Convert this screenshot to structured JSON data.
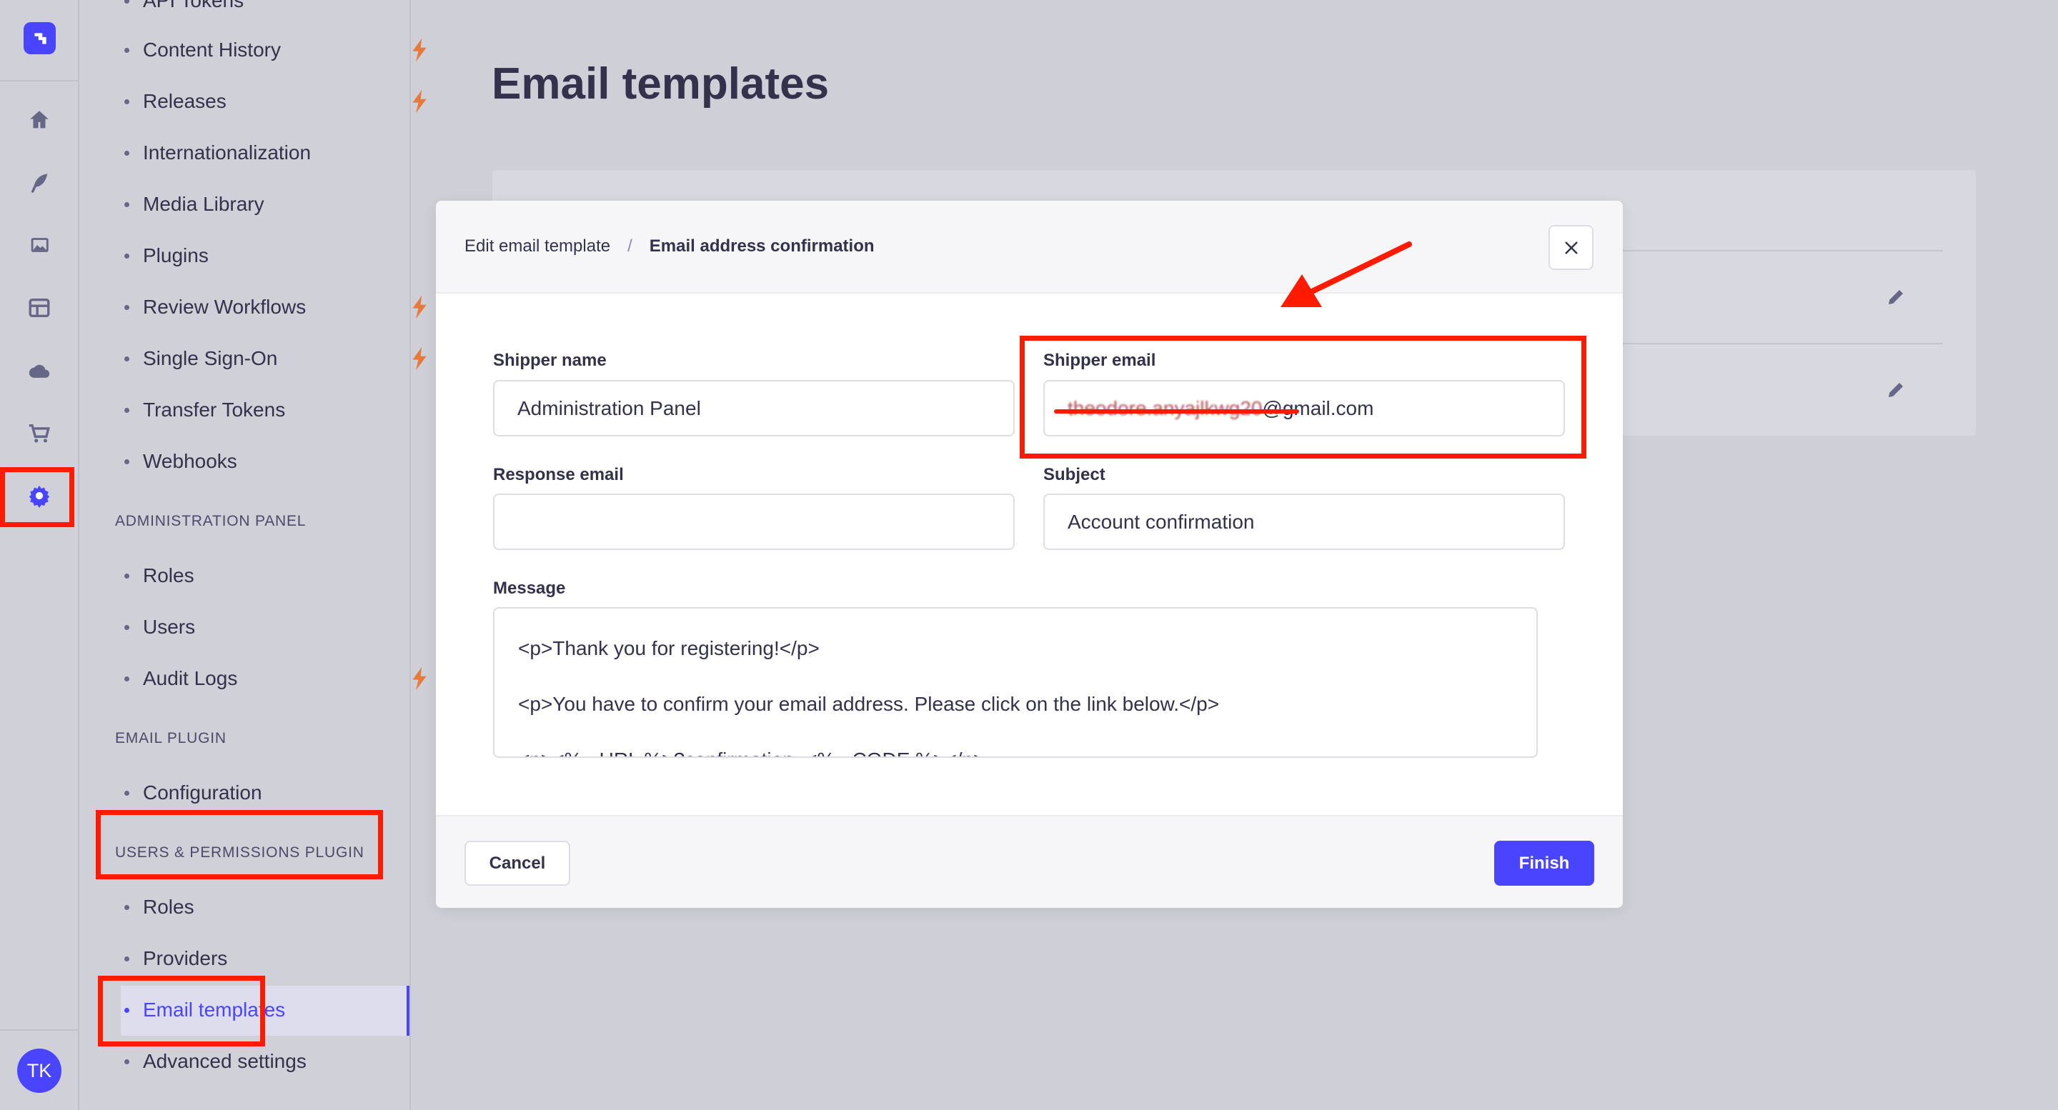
{
  "rail": {
    "logo": "strapi-logo-icon",
    "items": [
      "home-icon",
      "content-manager-icon",
      "media-icon",
      "layout-icon",
      "cloud-icon",
      "cart-icon",
      "settings-icon"
    ],
    "avatar": "TK"
  },
  "sidebar": {
    "top_partial": "API Tokens",
    "items_top": [
      {
        "label": "Content History",
        "premium": true
      },
      {
        "label": "Releases",
        "premium": true
      },
      {
        "label": "Internationalization",
        "premium": false
      },
      {
        "label": "Media Library",
        "premium": false
      },
      {
        "label": "Plugins",
        "premium": false
      },
      {
        "label": "Review Workflows",
        "premium": true
      },
      {
        "label": "Single Sign-On",
        "premium": true
      },
      {
        "label": "Transfer Tokens",
        "premium": false
      },
      {
        "label": "Webhooks",
        "premium": false
      }
    ],
    "section_admin": "ADMINISTRATION PANEL",
    "items_admin": [
      {
        "label": "Roles",
        "premium": false
      },
      {
        "label": "Users",
        "premium": false
      },
      {
        "label": "Audit Logs",
        "premium": true
      }
    ],
    "section_email": "EMAIL PLUGIN",
    "items_email": [
      {
        "label": "Configuration"
      }
    ],
    "section_up": "USERS & PERMISSIONS PLUGIN",
    "items_up": [
      {
        "label": "Roles"
      },
      {
        "label": "Providers"
      },
      {
        "label": "Email templates"
      },
      {
        "label": "Advanced settings"
      }
    ]
  },
  "page": {
    "title": "Email templates"
  },
  "modal": {
    "breadcrumb_parent": "Edit email template",
    "breadcrumb_sep": "/",
    "breadcrumb_current": "Email address confirmation",
    "fields": {
      "shipper_name_label": "Shipper name",
      "shipper_name_value": "Administration Panel",
      "shipper_email_label": "Shipper email",
      "shipper_email_hidden": "theodore.anyajlkwg20",
      "shipper_email_visible": "@gmail.com",
      "response_email_label": "Response email",
      "response_email_value": "",
      "subject_label": "Subject",
      "subject_value": "Account confirmation",
      "message_label": "Message",
      "message_line1": "<p>Thank you for registering!</p>",
      "message_line2": "<p>You have to confirm your email address. Please click on the link below.</p>",
      "message_line3": "<p><%= URL %>?confirmation=<%= CODE %></p>"
    },
    "cancel_label": "Cancel",
    "finish_label": "Finish"
  },
  "colors": {
    "primary": "#4945ff",
    "annotation": "#ff1a00",
    "premium": "#e8793a"
  }
}
